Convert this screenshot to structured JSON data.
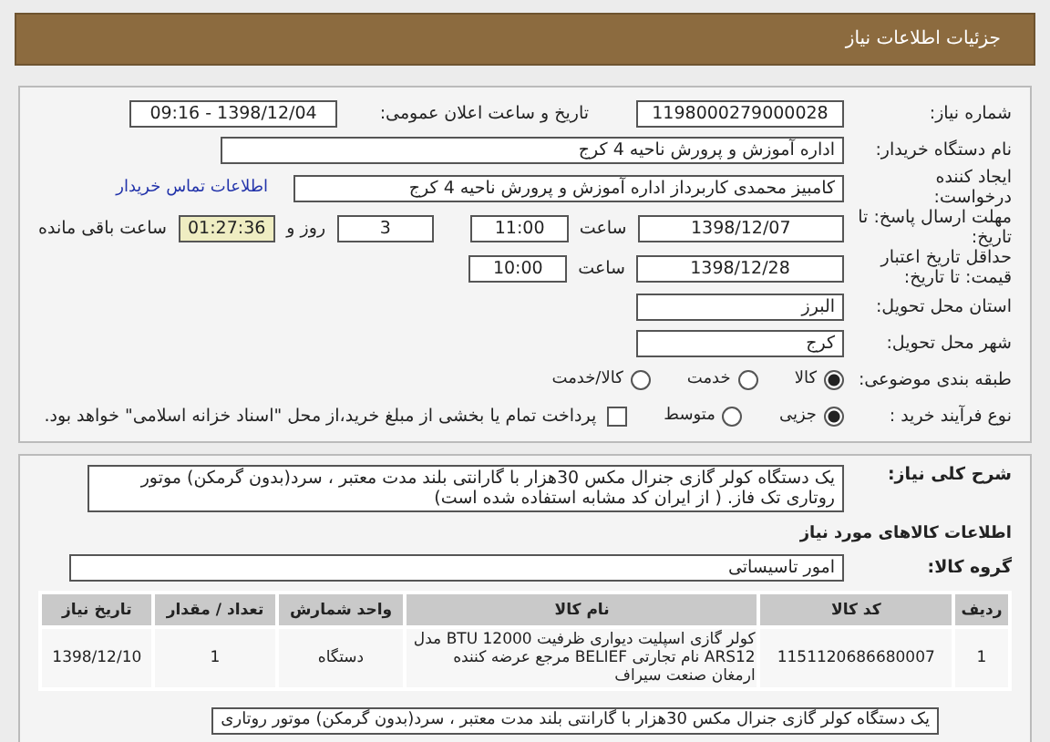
{
  "header": {
    "title": "جزئیات اطلاعات نیاز"
  },
  "need_number": {
    "label": "شماره نیاز:",
    "value": "1198000279000028"
  },
  "announce": {
    "label": "تاریخ و ساعت اعلان عمومی:",
    "value": "1398/12/04 - 09:16"
  },
  "buyer": {
    "label": "نام دستگاه خریدار:",
    "value": "اداره آموزش و پرورش ناحیه 4 کرج"
  },
  "requester": {
    "label": "ایجاد کننده درخواست:",
    "value": "کامبیز محمدی کاربرداز اداره آموزش و پرورش ناحیه 4 کرج",
    "link": "اطلاعات تماس خریدار"
  },
  "deadline": {
    "label": "مهلت ارسال پاسخ: تا تاریخ:",
    "date": "1398/12/07",
    "time_label": "ساعت",
    "time": "11:00",
    "days": "3",
    "days_label": "روز و",
    "remaining": "01:27:36",
    "remaining_label": "ساعت باقی مانده"
  },
  "validity": {
    "label": "حداقل تاریخ اعتبار قیمت: تا تاریخ:",
    "date": "1398/12/28",
    "time_label": "ساعت",
    "time": "10:00"
  },
  "province": {
    "label": "استان محل تحویل:",
    "value": "البرز"
  },
  "city": {
    "label": "شهر محل تحویل:",
    "value": "کرج"
  },
  "category": {
    "label": "طبقه بندی موضوعی:",
    "options": [
      {
        "label": "کالا",
        "selected": true
      },
      {
        "label": "خدمت",
        "selected": false
      },
      {
        "label": "کالا/خدمت",
        "selected": false
      }
    ]
  },
  "purchase": {
    "label": "نوع فرآیند خرید :",
    "options": [
      {
        "label": "جزیی",
        "selected": true
      },
      {
        "label": "متوسط",
        "selected": false
      }
    ],
    "treasury": {
      "label": "پرداخت تمام یا بخشی از مبلغ خرید،از محل \"اسناد خزانه اسلامی\" خواهد بود.",
      "checked": false
    }
  },
  "description": {
    "label": "شرح کلی نیاز:",
    "value": "یک دستگاه کولر گازی جنرال مکس 30هزار با گارانتی بلند مدت معتبر ، سرد(بدون گرمکن) موتور روتاری تک فاز. ( از ایران کد مشابه استفاده شده است)"
  },
  "goods_title": "اطلاعات کالاهای مورد نیاز",
  "goods_group": {
    "label": "گروه کالا:",
    "value": "امور تاسیساتی"
  },
  "table": {
    "columns": [
      "ردیف",
      "کد کالا",
      "نام کالا",
      "واحد شمارش",
      "تعداد / مقدار",
      "تاریخ نیاز"
    ],
    "rows": [
      [
        "1",
        "1151120686680007",
        "کولر گازی اسپلیت دیواری ظرفیت 12000 BTU مدل ARS12 نام تجارتی BELIEF مرجع عرضه کننده ارمغان صنعت سیراف",
        "دستگاه",
        "1",
        "1398/12/10"
      ]
    ]
  },
  "note": "یک دستگاه کولر گازی جنرال مکس 30هزار با گارانتی بلند مدت معتبر ، سرد(بدون گرمکن) موتور روتاری"
}
